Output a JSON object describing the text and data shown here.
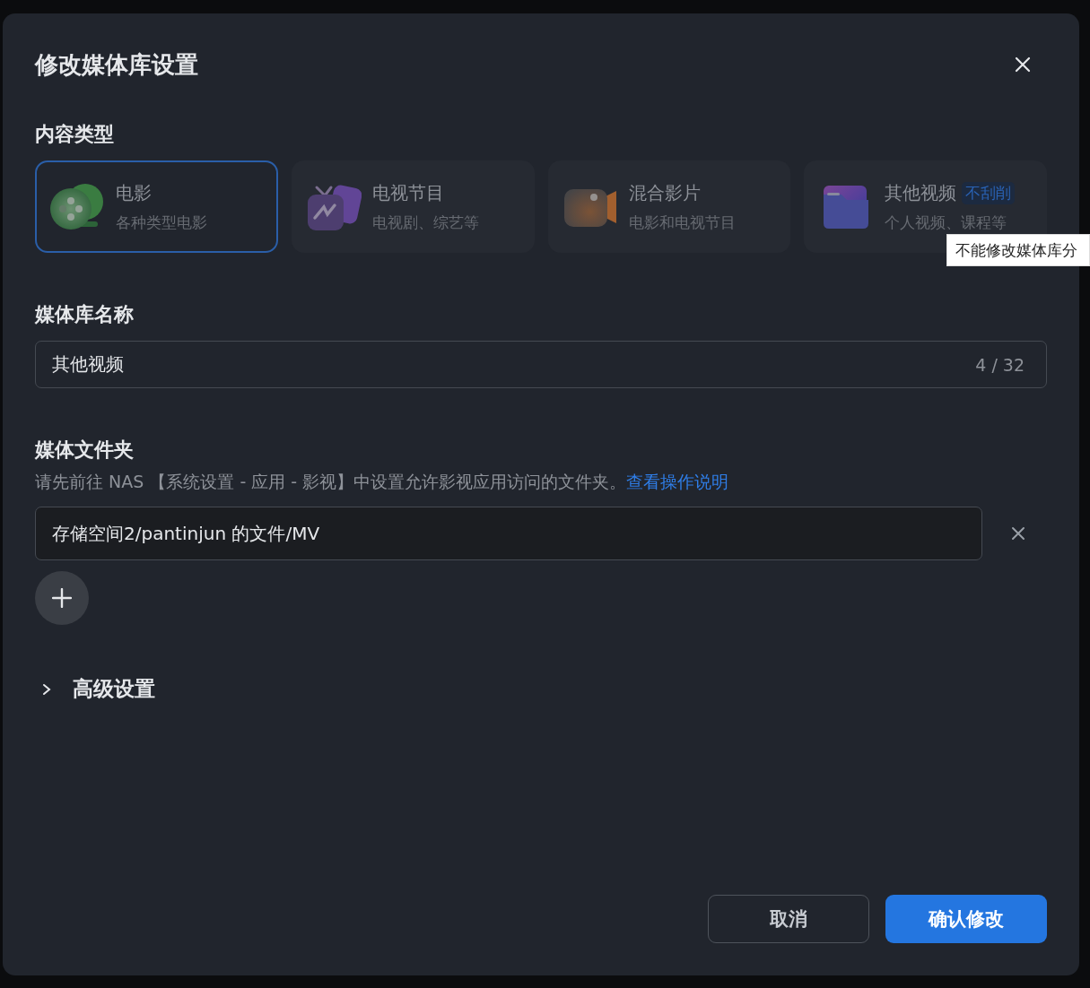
{
  "dialog": {
    "title": "修改媒体库设置"
  },
  "content_type": {
    "label": "内容类型",
    "options": [
      {
        "kind": "film",
        "title": "电影",
        "subtitle": "各种类型电影",
        "selected": true
      },
      {
        "kind": "tv",
        "title": "电视节目",
        "subtitle": "电视剧、综艺等",
        "selected": false
      },
      {
        "kind": "camera",
        "title": "混合影片",
        "subtitle": "电影和电视节目",
        "selected": false
      },
      {
        "kind": "folder",
        "title": "其他视频",
        "badge": "不刮削",
        "subtitle": "个人视频、课程等",
        "selected": false
      }
    ]
  },
  "tooltip": {
    "text": "不能修改媒体库分"
  },
  "library_name": {
    "label": "媒体库名称",
    "value": "其他视频",
    "counter": "4 / 32"
  },
  "media_folder": {
    "label": "媒体文件夹",
    "help": "请先前往 NAS 【系统设置 - 应用 - 影视】中设置允许影视应用访问的文件夹。",
    "help_link": "查看操作说明",
    "folders": [
      "存储空间2/pantinjun 的文件/MV"
    ]
  },
  "advanced": {
    "label": "高级设置",
    "expanded": false
  },
  "buttons": {
    "cancel": "取消",
    "confirm": "确认修改"
  }
}
